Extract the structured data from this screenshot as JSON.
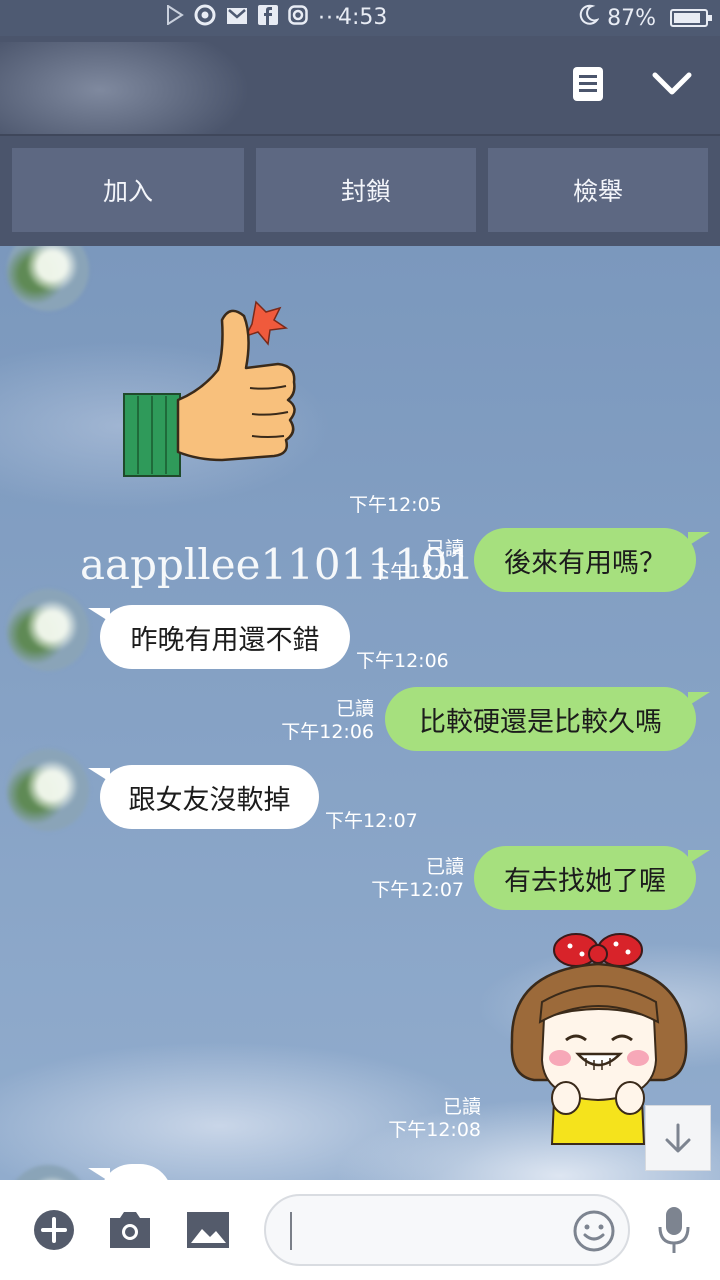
{
  "status_bar": {
    "time": "4:53",
    "battery_percent_text": "87%",
    "battery_level": 0.87,
    "icons": [
      "play-store-icon",
      "chrome-icon",
      "gmail-icon",
      "facebook-icon",
      "instagram-icon",
      "more-dots-icon",
      "do-not-disturb-moon-icon",
      "battery-icon"
    ],
    "dots": "···"
  },
  "header": {
    "icons": [
      "note-icon",
      "chevron-down-icon"
    ]
  },
  "actions": {
    "add_label": "加入",
    "block_label": "封鎖",
    "report_label": "檢舉"
  },
  "chat": {
    "watermark": "aappllee11011101",
    "messages": [
      {
        "id": "m0",
        "from": "other",
        "type": "sticker",
        "sticker": "thumbs-up-sticker",
        "time": "下午12:05"
      },
      {
        "id": "m1",
        "from": "me",
        "text": "後來有用嗎？",
        "read": "已讀",
        "time": "下午12:05"
      },
      {
        "id": "m2",
        "from": "other",
        "text": "昨晚有用還不錯",
        "time": "下午12:06"
      },
      {
        "id": "m3",
        "from": "me",
        "text": "比較硬還是比較久嗎",
        "read": "已讀",
        "time": "下午12:06"
      },
      {
        "id": "m4",
        "from": "other",
        "text": "跟女友沒軟掉",
        "time": "下午12:07"
      },
      {
        "id": "m5",
        "from": "me",
        "text": "有去找她了喔",
        "read": "已讀",
        "time": "下午12:07"
      },
      {
        "id": "m6",
        "from": "me",
        "type": "sticker",
        "sticker": "laughing-girl-sticker",
        "read": "已讀",
        "time": "下午12:08"
      }
    ]
  },
  "input_bar": {
    "icons": [
      "plus-icon",
      "camera-icon",
      "image-icon",
      "emoji-icon",
      "microphone-icon"
    ],
    "input_value": "",
    "scroll_icon": "arrow-down-icon"
  },
  "colors": {
    "header_bg": "#4b556c",
    "button_bg": "#5d6882",
    "my_bubble": "#a6e07e",
    "their_bubble": "#ffffff",
    "chat_bg": "#7f9cc1"
  }
}
